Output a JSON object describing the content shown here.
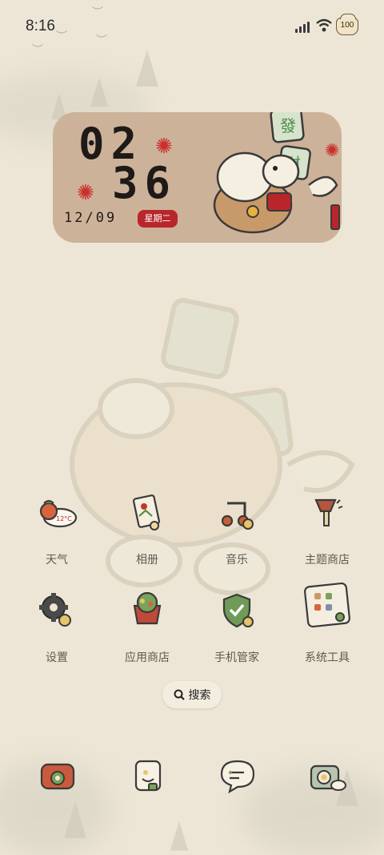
{
  "status_bar": {
    "time": "8:16",
    "battery_level": "100",
    "icons": [
      "signal-icon",
      "wifi-icon",
      "battery-icon"
    ]
  },
  "clock_widget": {
    "hour": "02",
    "minute": "36",
    "date": "12/09",
    "weekday": "星期二",
    "accent_color": "#b8262b"
  },
  "apps": [
    {
      "label": "天气",
      "icon": "weather-icon",
      "icon_text": "12°C"
    },
    {
      "label": "相册",
      "icon": "gallery-icon"
    },
    {
      "label": "音乐",
      "icon": "music-icon"
    },
    {
      "label": "主题商店",
      "icon": "theme-store-icon"
    },
    {
      "label": "设置",
      "icon": "settings-icon"
    },
    {
      "label": "应用商店",
      "icon": "app-store-icon"
    },
    {
      "label": "手机管家",
      "icon": "phone-manager-icon"
    },
    {
      "label": "系统工具",
      "icon": "system-tools-icon"
    }
  ],
  "search": {
    "label": "搜索",
    "icon": "search-icon"
  },
  "dock": [
    {
      "icon": "phone-icon"
    },
    {
      "icon": "contacts-icon"
    },
    {
      "icon": "messages-icon"
    },
    {
      "icon": "camera-icon"
    }
  ],
  "colors": {
    "background": "#ede6d6",
    "widget_bg": "#cdb29a",
    "label": "#5e5a52"
  }
}
